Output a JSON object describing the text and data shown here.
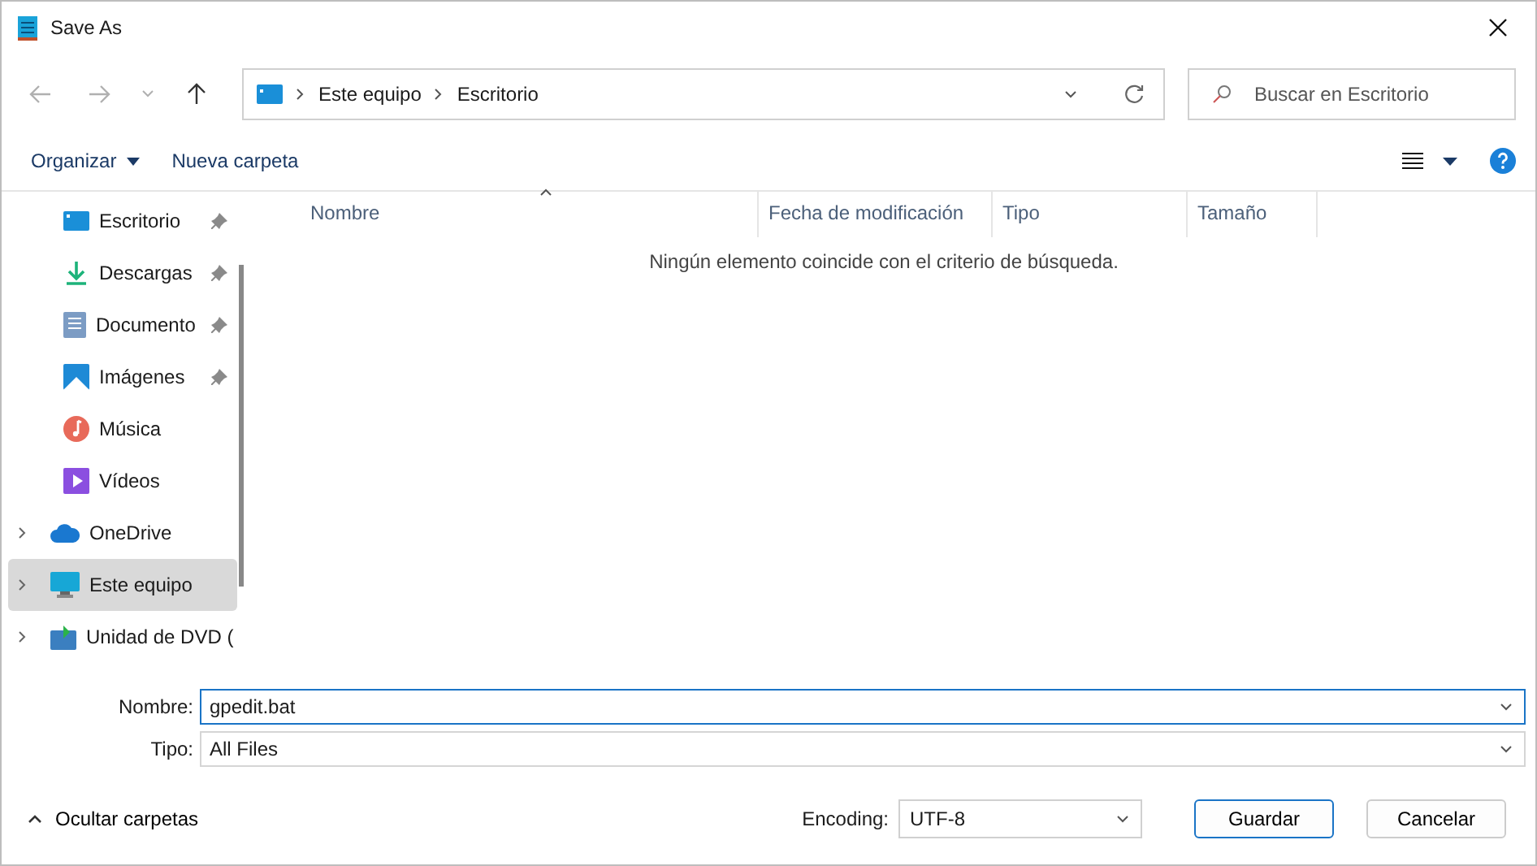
{
  "window": {
    "title": "Save As"
  },
  "nav": [
    {
      "kind": "back",
      "disabled": true
    },
    {
      "kind": "forward",
      "disabled": true
    },
    {
      "kind": "recent",
      "disabled": true
    },
    {
      "kind": "up",
      "disabled": false
    }
  ],
  "address": {
    "crumbs": [
      "Este equipo",
      "Escritorio"
    ]
  },
  "search": {
    "placeholder": "Buscar en Escritorio"
  },
  "toolbar": {
    "organize": "Organizar",
    "new_folder": "Nueva carpeta"
  },
  "sidebar": {
    "items": [
      {
        "label": "Escritorio",
        "kind": "quick",
        "pinned": true,
        "selected": false
      },
      {
        "label": "Descargas",
        "kind": "quick",
        "pinned": true,
        "selected": false
      },
      {
        "label": "Documento",
        "kind": "quick",
        "pinned": true,
        "selected": false
      },
      {
        "label": "Imágenes",
        "kind": "quick",
        "pinned": true,
        "selected": false
      },
      {
        "label": "Música",
        "kind": "quick",
        "pinned": false,
        "selected": false
      },
      {
        "label": "Vídeos",
        "kind": "quick",
        "pinned": false,
        "selected": false
      },
      {
        "label": "OneDrive",
        "kind": "root",
        "selected": false
      },
      {
        "label": "Este equipo",
        "kind": "root",
        "selected": true
      },
      {
        "label": "Unidad de DVD (",
        "kind": "root",
        "selected": false
      }
    ]
  },
  "columns": [
    {
      "label": "Nombre",
      "sorted": true
    },
    {
      "label": "Fecha de modificación",
      "sorted": false
    },
    {
      "label": "Tipo",
      "sorted": false
    },
    {
      "label": "Tamaño",
      "sorted": false
    }
  ],
  "empty_message": "Ningún elemento coincide con el criterio de búsqueda.",
  "file_name": {
    "label": "Nombre:",
    "value": "gpedit.bat"
  },
  "file_type": {
    "label": "Tipo:",
    "value": "All Files"
  },
  "hide_folders": "Ocultar carpetas",
  "encoding": {
    "label": "Encoding:",
    "value": "UTF-8"
  },
  "buttons": [
    {
      "label": "Guardar",
      "default": true
    },
    {
      "label": "Cancelar",
      "default": false
    }
  ]
}
